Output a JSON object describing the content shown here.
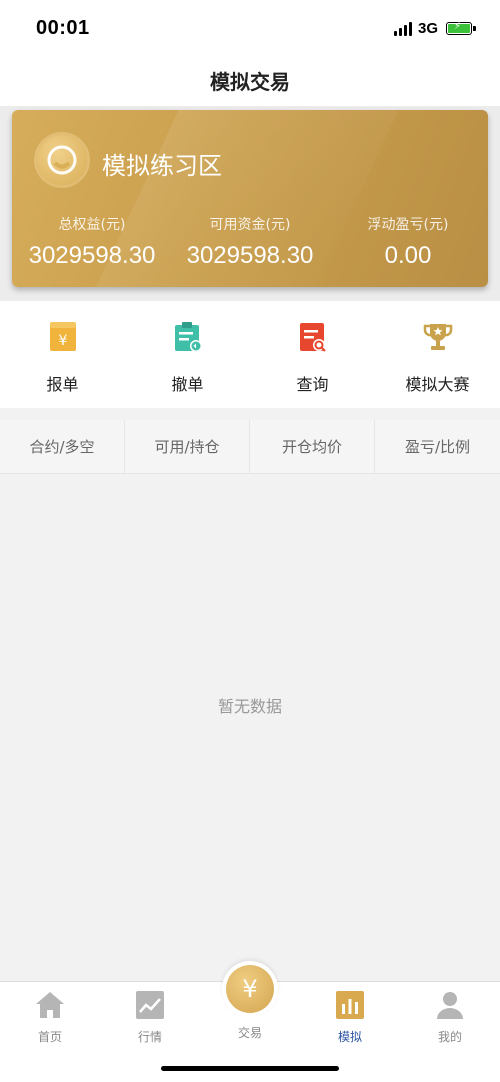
{
  "status": {
    "time": "00:01",
    "network": "3G"
  },
  "nav": {
    "title": "模拟交易"
  },
  "card": {
    "title": "模拟练习区",
    "stats": [
      {
        "label": "总权益(元)",
        "value": "3029598.30"
      },
      {
        "label": "可用资金(元)",
        "value": "3029598.30"
      },
      {
        "label": "浮动盈亏(元)",
        "value": "0.00"
      }
    ]
  },
  "actions": [
    {
      "label": "报单",
      "icon": "order-icon",
      "color": "#f0b43c"
    },
    {
      "label": "撤单",
      "icon": "cancel-order-icon",
      "color": "#3fbfa8"
    },
    {
      "label": "查询",
      "icon": "query-icon",
      "color": "#e8472f"
    },
    {
      "label": "模拟大赛",
      "icon": "trophy-icon",
      "color": "#c9a24d"
    }
  ],
  "table": {
    "headers": [
      "合约/多空",
      "可用/持仓",
      "开仓均价",
      "盈亏/比例"
    ],
    "empty_text": "暂无数据"
  },
  "tabbar": {
    "items": [
      {
        "label": "首页",
        "icon": "home-icon"
      },
      {
        "label": "行情",
        "icon": "chart-icon"
      },
      {
        "label": "交易",
        "icon": "yuan-icon"
      },
      {
        "label": "模拟",
        "icon": "bar-chart-icon",
        "active": true
      },
      {
        "label": "我的",
        "icon": "user-icon"
      }
    ],
    "center_symbol": "¥",
    "accent": "#2f56a3"
  }
}
